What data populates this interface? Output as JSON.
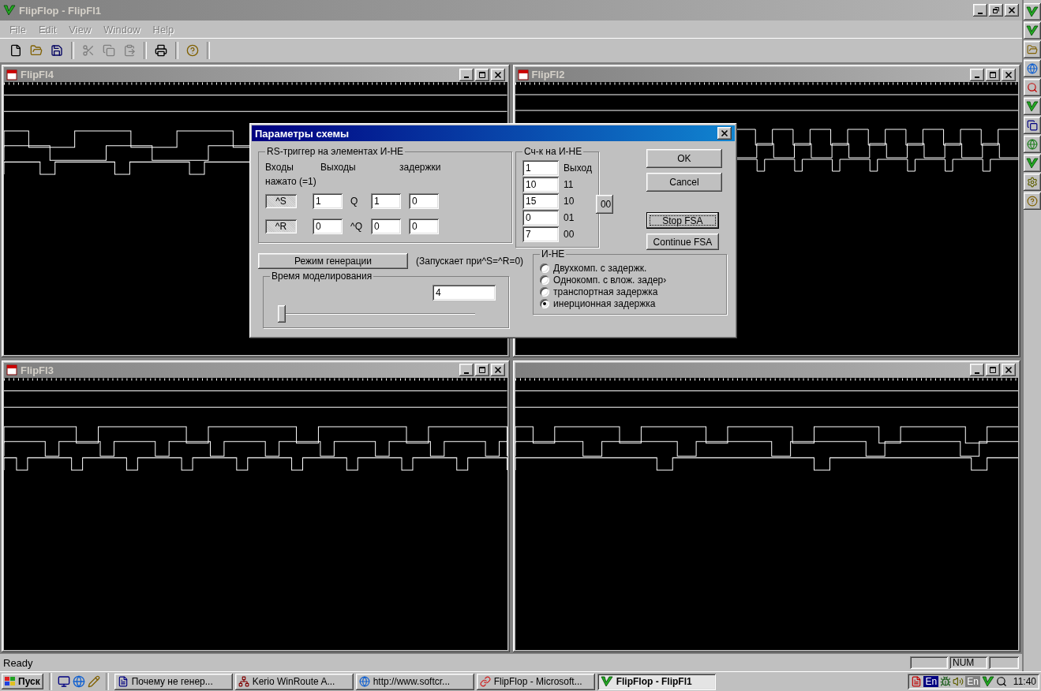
{
  "window": {
    "title": "FlipFlop - FlipFl1"
  },
  "menu": [
    {
      "label": "File"
    },
    {
      "label": "Edit"
    },
    {
      "label": "View"
    },
    {
      "label": "Window"
    },
    {
      "label": "Help"
    }
  ],
  "documents": [
    {
      "title": "FlipFl4"
    },
    {
      "title": "FlipFl2"
    },
    {
      "title": "FlipFl3"
    }
  ],
  "dialog": {
    "title": "Параметры схемы",
    "rs_group": {
      "legend": "RS-триггер на элементах И-НЕ",
      "headers": [
        "Входы",
        "Выходы",
        "задержки"
      ],
      "note": "нажато (=1)",
      "rows": [
        {
          "input": "^S",
          "output": "1",
          "output_label": "Q",
          "delays": [
            "1",
            "0"
          ]
        },
        {
          "input": "^R",
          "output": "0",
          "output_label": "^Q",
          "delays": [
            "0",
            "0"
          ]
        }
      ]
    },
    "counter_group": {
      "legend": "Сч-к на И-НЕ",
      "button": "00",
      "rows": [
        {
          "value": "1",
          "label": "Выход"
        },
        {
          "value": "10",
          "label": "11"
        },
        {
          "value": "15",
          "label": "10"
        },
        {
          "value": "0",
          "label": "01"
        },
        {
          "value": "7",
          "label": "00"
        }
      ]
    },
    "buttons": [
      {
        "label": "OK",
        "focused": false
      },
      {
        "label": "Cancel",
        "focused": false
      }
    ],
    "fsa_buttons": [
      {
        "label": "Stop FSA",
        "focused": true
      },
      {
        "label": "Continue FSA",
        "focused": false
      }
    ],
    "generation": {
      "button": "Режим генерации",
      "note": "(Запускает при^S=^R=0)"
    },
    "time_group": {
      "legend": "Время моделирования",
      "value": "4",
      "slider": {
        "level": 0
      }
    },
    "gate_group": {
      "legend": "И-НЕ",
      "options": [
        {
          "label": "Двухкомп. с задержк.",
          "selected": false
        },
        {
          "label": "Однокомп. с влож. задер›",
          "selected": false
        },
        {
          "label": "транспортная задержка",
          "selected": false
        },
        {
          "label": "инерционная задержка",
          "selected": true
        }
      ]
    }
  },
  "status_bar": {
    "text": "Ready",
    "indicator": "NUM"
  },
  "taskbar": {
    "start": "Пуск",
    "tasks": [
      {
        "label": "Почему не генер...",
        "kind": "document",
        "selected": false
      },
      {
        "label": "Kerio WinRoute A...",
        "kind": "network",
        "selected": false
      },
      {
        "label": "http://www.softcr...",
        "kind": "browser",
        "selected": false
      },
      {
        "label": "FlipFlop - Microsoft...",
        "kind": "link",
        "selected": false
      },
      {
        "label": "FlipFlop - FlipFl1",
        "kind": "app",
        "selected": true
      }
    ],
    "tray": {
      "language": [
        "En",
        "En"
      ],
      "clock": "11:40"
    }
  }
}
